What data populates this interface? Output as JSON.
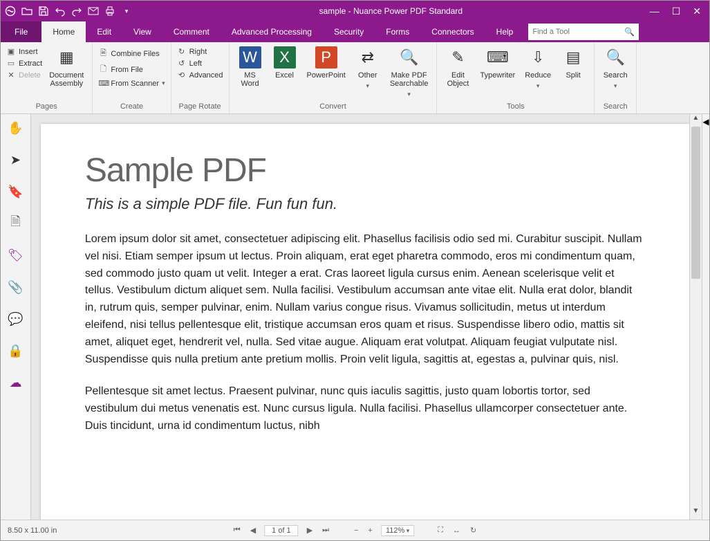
{
  "title": "sample - Nuance Power PDF Standard",
  "menu": {
    "file": "File",
    "tabs": [
      "Home",
      "Edit",
      "View",
      "Comment",
      "Advanced Processing",
      "Security",
      "Forms",
      "Connectors",
      "Help"
    ],
    "active": "Home",
    "search_placeholder": "Find a Tool"
  },
  "ribbon": {
    "pages": {
      "label": "Pages",
      "insert": "Insert",
      "extract": "Extract",
      "delete": "Delete",
      "doc_assembly": "Document\nAssembly"
    },
    "create": {
      "label": "Create",
      "combine": "Combine Files",
      "from_file": "From File",
      "from_scanner": "From Scanner"
    },
    "rotate": {
      "label": "Page Rotate",
      "right": "Right",
      "left": "Left",
      "advanced": "Advanced"
    },
    "convert": {
      "label": "Convert",
      "word": "MS\nWord",
      "excel": "Excel",
      "ppt": "PowerPoint",
      "other": "Other",
      "searchable": "Make PDF\nSearchable"
    },
    "tools": {
      "label": "Tools",
      "edit_obj": "Edit\nObject",
      "typewriter": "Typewriter",
      "reduce": "Reduce",
      "split": "Split"
    },
    "search": {
      "label": "Search",
      "search": "Search"
    }
  },
  "document": {
    "heading": "Sample PDF",
    "subtitle": "This is a simple PDF file. Fun fun fun.",
    "para1": "Lorem ipsum dolor sit amet, consectetuer adipiscing elit. Phasellus facilisis odio sed mi. Curabitur suscipit. Nullam vel nisi. Etiam semper ipsum ut lectus. Proin aliquam, erat eget pharetra commodo, eros mi condimentum quam, sed commodo justo quam ut velit. Integer a erat. Cras laoreet ligula cursus enim. Aenean scelerisque velit et tellus. Vestibulum dictum aliquet sem. Nulla facilisi. Vestibulum accumsan ante vitae elit. Nulla erat dolor, blandit in, rutrum quis, semper pulvinar, enim. Nullam varius congue risus. Vivamus sollicitudin, metus ut interdum eleifend, nisi tellus pellentesque elit, tristique accumsan eros quam et risus. Suspendisse libero odio, mattis sit amet, aliquet eget, hendrerit vel, nulla. Sed vitae augue. Aliquam erat volutpat. Aliquam feugiat vulputate nisl. Suspendisse quis nulla pretium ante pretium mollis. Proin velit ligula, sagittis at, egestas a, pulvinar quis, nisl.",
    "para2": "Pellentesque sit amet lectus. Praesent pulvinar, nunc quis iaculis sagittis, justo quam lobortis tortor, sed vestibulum dui metus venenatis est. Nunc cursus ligula. Nulla facilisi. Phasellus ullamcorper consectetuer ante. Duis tincidunt, urna id condimentum luctus, nibh"
  },
  "status": {
    "page_size": "8.50 x 11.00 in",
    "page_of": "1 of 1",
    "zoom": "112%"
  }
}
